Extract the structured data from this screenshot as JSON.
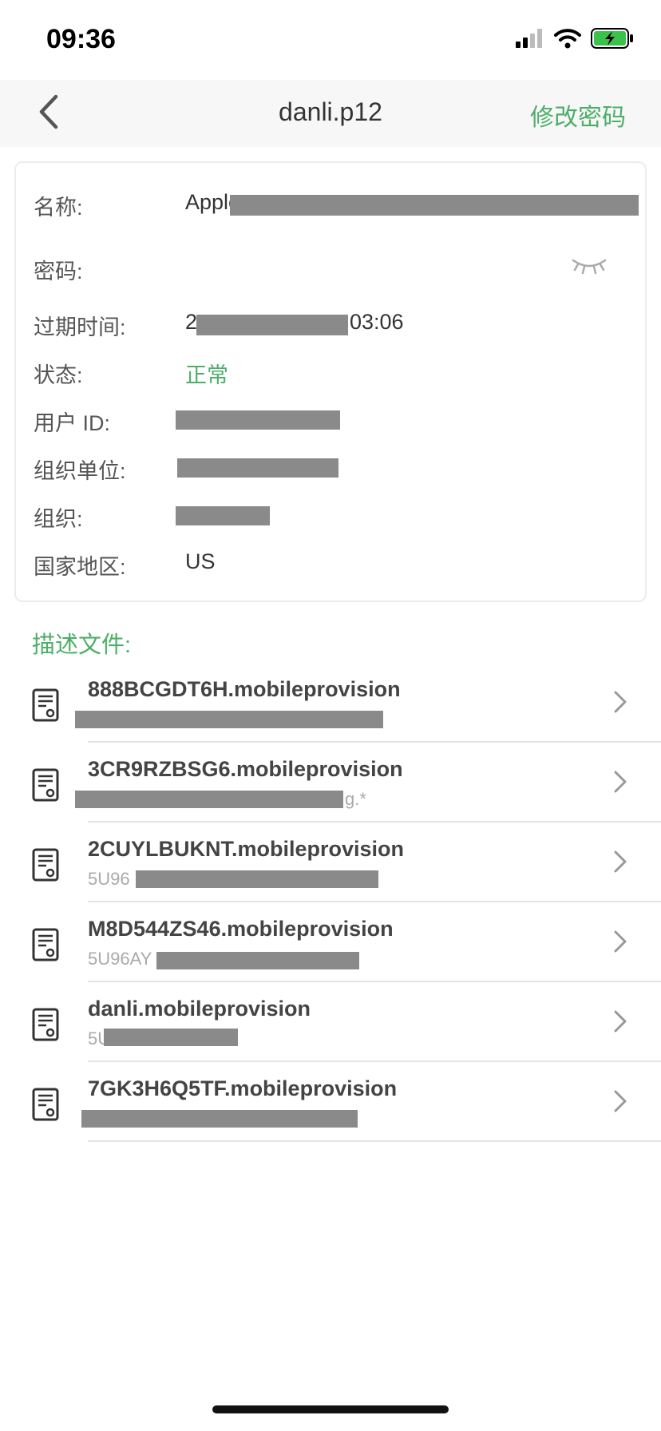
{
  "status": {
    "time": "09:36"
  },
  "nav": {
    "title": "danli.p12",
    "action": "修改密码",
    "back_icon": "chevron-left-icon"
  },
  "info": {
    "name_label": "名称:",
    "name_value": "Apple",
    "password_label": "密码:",
    "expiry_label": "过期时间:",
    "expiry_prefix": "2",
    "expiry_suffix": "03:06",
    "status_label": "状态:",
    "status_value": "正常",
    "user_id_label": "用户 ID:",
    "org_unit_label": "组织单位:",
    "org_label": "组织:",
    "country_label": "国家地区:",
    "country_value": "US"
  },
  "section_title": "描述文件:",
  "profiles": [
    {
      "name": "888BCGDT6H.mobileprovision",
      "sub": ""
    },
    {
      "name": "3CR9RZBSG6.mobileprovision",
      "sub": "g.*"
    },
    {
      "name": "2CUYLBUKNT.mobileprovision",
      "sub": "5U96"
    },
    {
      "name": "M8D544ZS46.mobileprovision",
      "sub": "5U96AY"
    },
    {
      "name": "danli.mobileprovision",
      "sub": "5U"
    },
    {
      "name": "7GK3H6Q5TF.mobileprovision",
      "sub": ""
    }
  ],
  "colors": {
    "accent": "#4caf68",
    "redaction": "#8a8a8a"
  }
}
